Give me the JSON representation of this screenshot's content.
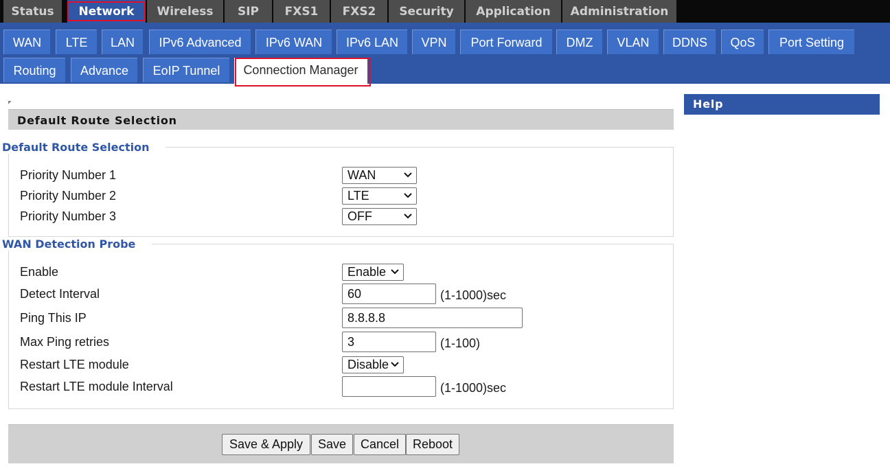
{
  "top_nav": {
    "tabs": [
      {
        "label": "Status",
        "active": false
      },
      {
        "label": "Network",
        "active": true
      },
      {
        "label": "Wireless",
        "active": false
      },
      {
        "label": "SIP",
        "active": false
      },
      {
        "label": "FXS1",
        "active": false
      },
      {
        "label": "FXS2",
        "active": false
      },
      {
        "label": "Security",
        "active": false
      },
      {
        "label": "Application",
        "active": false
      },
      {
        "label": "Administration",
        "active": false
      }
    ]
  },
  "sub_nav": {
    "tabs": [
      {
        "label": "WAN",
        "active": false
      },
      {
        "label": "LTE",
        "active": false
      },
      {
        "label": "LAN",
        "active": false
      },
      {
        "label": "IPv6 Advanced",
        "active": false
      },
      {
        "label": "IPv6 WAN",
        "active": false
      },
      {
        "label": "IPv6 LAN",
        "active": false
      },
      {
        "label": "VPN",
        "active": false
      },
      {
        "label": "Port Forward",
        "active": false
      },
      {
        "label": "DMZ",
        "active": false
      },
      {
        "label": "VLAN",
        "active": false
      },
      {
        "label": "DDNS",
        "active": false
      },
      {
        "label": "QoS",
        "active": false
      },
      {
        "label": "Port Setting",
        "active": false
      },
      {
        "label": "Routing",
        "active": false
      },
      {
        "label": "Advance",
        "active": false
      },
      {
        "label": "EoIP Tunnel",
        "active": false
      },
      {
        "label": "Connection Manager",
        "active": true
      }
    ]
  },
  "page": {
    "section_title": "Default Route Selection",
    "help_title": "Help"
  },
  "default_route": {
    "legend": "Default Route Selection",
    "rows": [
      {
        "label": "Priority Number 1",
        "value": "WAN"
      },
      {
        "label": "Priority Number 2",
        "value": "LTE"
      },
      {
        "label": "Priority Number 3",
        "value": "OFF"
      }
    ]
  },
  "wan_probe": {
    "legend": "WAN Detection Probe",
    "enable": {
      "label": "Enable",
      "value": "Enable"
    },
    "detect_interval": {
      "label": "Detect Interval",
      "value": "60",
      "unit": "(1-1000)sec"
    },
    "ping_ip": {
      "label": "Ping This IP",
      "value": "8.8.8.8"
    },
    "max_ping": {
      "label": "Max Ping retries",
      "value": "3",
      "unit": "(1-100)"
    },
    "restart_lte": {
      "label": "Restart LTE module",
      "value": "Disable"
    },
    "restart_interval": {
      "label": "Restart LTE module Interval",
      "value": "",
      "unit": "(1-1000)sec"
    }
  },
  "buttons": {
    "save_apply": "Save & Apply",
    "save": "Save",
    "cancel": "Cancel",
    "reboot": "Reboot"
  },
  "colors": {
    "nav_blue": "#2f57a6",
    "tab_blue": "#3d6fc9",
    "highlight_red": "#e0102a",
    "top_bar": "#0a0a0a",
    "top_tab": "#4d4d4d",
    "section_gray": "#d0d0d0"
  }
}
